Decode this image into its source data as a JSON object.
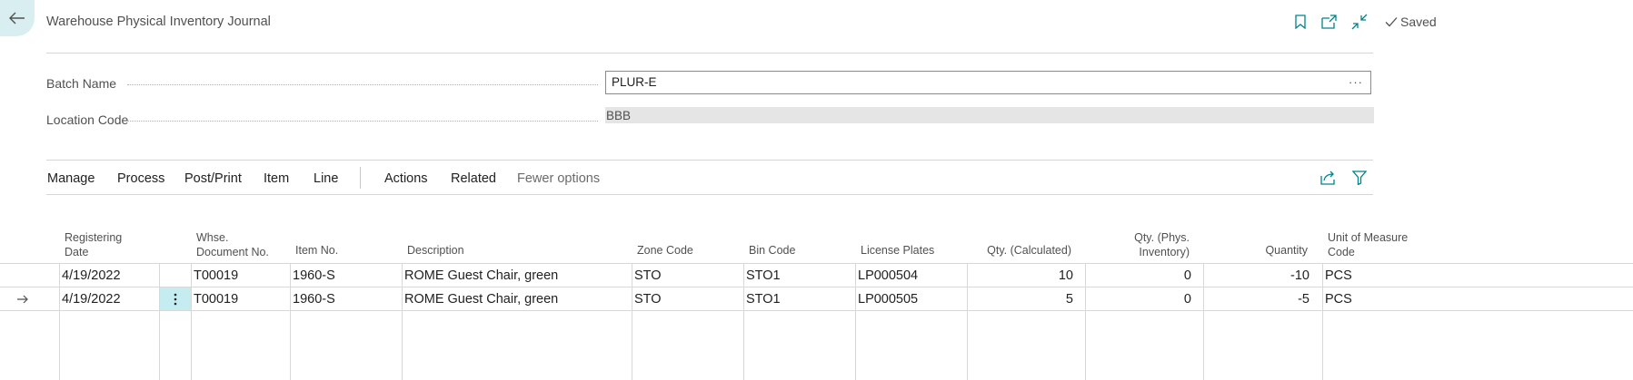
{
  "header": {
    "title": "Warehouse Physical Inventory Journal",
    "saved_label": "Saved"
  },
  "icons": {
    "back": "arrow-left-icon",
    "bookmark": "bookmark-icon",
    "open_new": "open-in-new-window-icon",
    "collapse": "collapse-icon",
    "share": "share-icon",
    "filter": "filter-icon",
    "row_menu": "vertical-ellipsis-icon",
    "row_selected": "arrow-right-icon"
  },
  "fields": {
    "batch_name": {
      "label": "Batch Name",
      "value": "PLUR-E",
      "lookup": "···"
    },
    "location_code": {
      "label": "Location Code",
      "value": "BBB"
    }
  },
  "menu": {
    "items": [
      "Manage",
      "Process",
      "Post/Print",
      "Item",
      "Line",
      "Actions",
      "Related",
      "Fewer options"
    ]
  },
  "table": {
    "columns": [
      "Registering Date",
      "Whse. Document No.",
      "Item No.",
      "Description",
      "Zone Code",
      "Bin Code",
      "License Plates",
      "Qty. (Calculated)",
      "Qty. (Phys. Inventory)",
      "Quantity",
      "Unit of Measure Code"
    ],
    "column_lines": {
      "reg_date": [
        "Registering",
        "Date"
      ],
      "whse_doc": [
        "Whse.",
        "Document No."
      ],
      "qty_phys": [
        "Qty. (Phys.",
        "Inventory)"
      ],
      "uom": [
        "Unit of Measure",
        "Code"
      ]
    },
    "rows": [
      {
        "date": "4/19/2022",
        "doc": "T00019",
        "item": "1960-S",
        "desc": "ROME Guest Chair, green",
        "zone": "STO",
        "bin": "STO1",
        "lp": "LP000504",
        "qty_calc": "10",
        "qty_phys": "0",
        "qty": "-10",
        "uom": "PCS"
      },
      {
        "date": "4/19/2022",
        "doc": "T00019",
        "item": "1960-S",
        "desc": "ROME Guest Chair, green",
        "zone": "STO",
        "bin": "STO1",
        "lp": "LP000505",
        "qty_calc": "5",
        "qty_phys": "0",
        "qty": "-5",
        "uom": "PCS"
      }
    ]
  },
  "colors": {
    "accent": "#008489",
    "back_bg": "#d9eef1",
    "row_menu_bg": "#c5ecf1",
    "readonly_bg": "#e5e5e5"
  }
}
